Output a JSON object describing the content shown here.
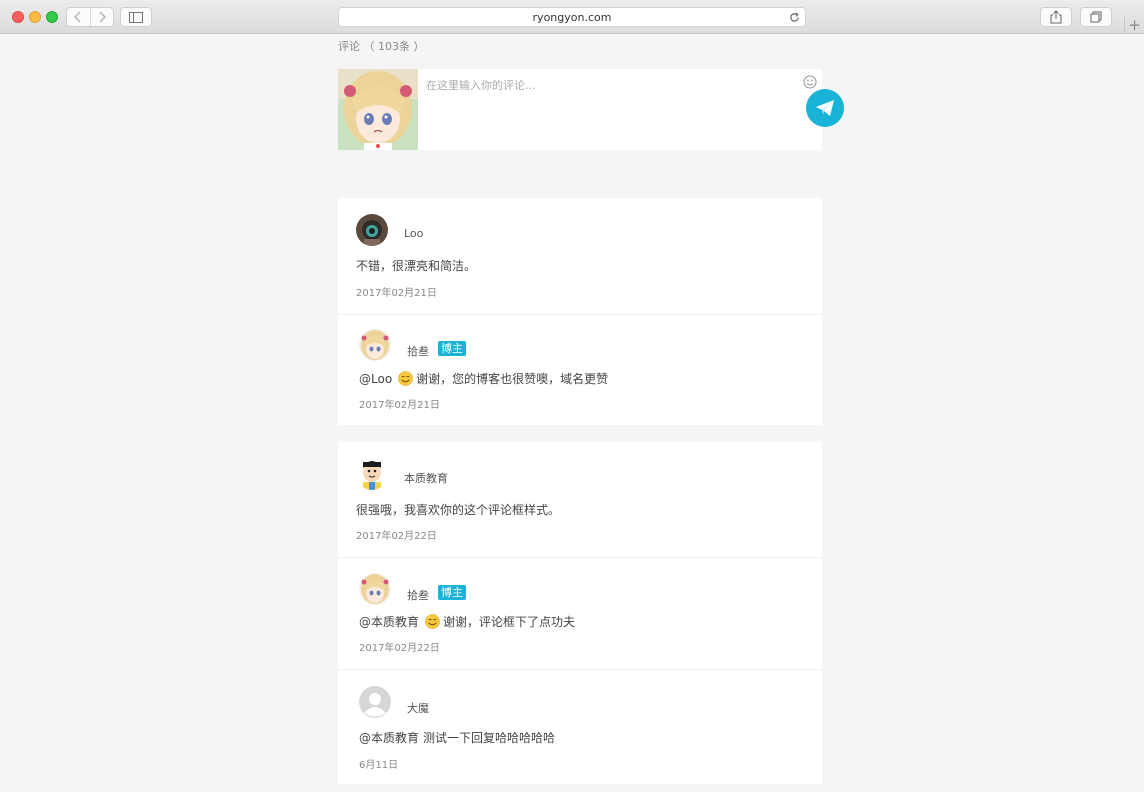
{
  "browser": {
    "url": "ryongyon.com"
  },
  "comments_header": {
    "count_label": "评论 （ 103条 ）"
  },
  "compose": {
    "placeholder": "在这里输入你的评论..."
  },
  "threads": [
    {
      "comment": {
        "author": "Loo",
        "text": "不错，很漂亮和简洁。",
        "date": "2017年02月21日"
      },
      "replies": [
        {
          "author": "拾叁",
          "badge": "博主",
          "mention": "@Loo",
          "text": "谢谢，您的博客也很赞噢，域名更赞",
          "date": "2017年02月21日"
        }
      ]
    },
    {
      "comment": {
        "author": "本质教育",
        "text": "很强哦，我喜欢你的这个评论框样式。",
        "date": "2017年02月22日"
      },
      "replies": [
        {
          "author": "拾叁",
          "badge": "博主",
          "mention": "@本质教育",
          "text": "谢谢，评论框下了点功夫",
          "date": "2017年02月22日"
        },
        {
          "author": "大魔",
          "mention": "@本质教育",
          "text": "测试一下回复哈哈哈哈哈",
          "date": "6月11日"
        }
      ]
    }
  ],
  "colors": {
    "accent": "#1ab3d8",
    "page_background": "#f5f5f5"
  }
}
